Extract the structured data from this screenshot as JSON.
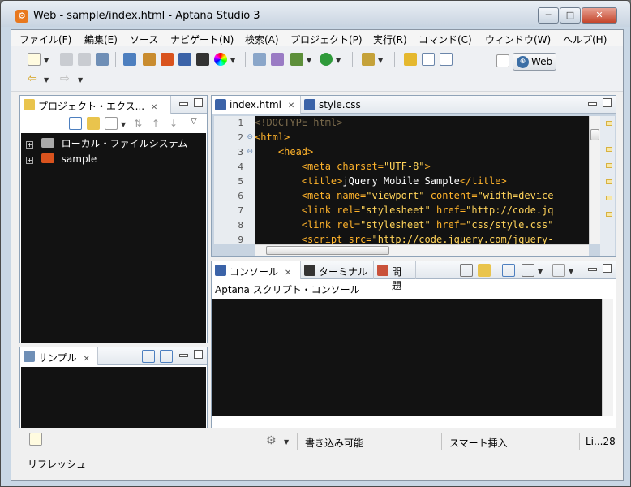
{
  "window": {
    "title": "Web - sample/index.html - Aptana Studio 3",
    "app_icon": "gear-icon",
    "controls": {
      "minimize": "─",
      "maximize": "□",
      "close": "✕"
    }
  },
  "menu": [
    "ファイル(F)",
    "編集(E)",
    "ソース",
    "ナビゲート(N)",
    "検索(A)",
    "プロジェクト(P)",
    "実行(R)",
    "コマンド(C)",
    "ウィンドウ(W)",
    "ヘルプ(H)"
  ],
  "perspective": {
    "label": "Web"
  },
  "project_explorer": {
    "tab_label": "プロジェクト・エクス...",
    "items": [
      {
        "label": "ローカル・ファイルシステム",
        "icon": "drive-icon"
      },
      {
        "label": "sample",
        "icon": "web-project-icon"
      }
    ]
  },
  "samples": {
    "tab_label": "サンプル"
  },
  "editor": {
    "tabs": [
      {
        "label": "index.html",
        "active": true
      },
      {
        "label": "style.css",
        "active": false
      }
    ],
    "lines": [
      {
        "n": "1",
        "fold": "",
        "indent": "",
        "parts": [
          [
            "doc",
            "<!DOCTYPE html>"
          ]
        ]
      },
      {
        "n": "2",
        "fold": "⊖",
        "indent": "",
        "parts": [
          [
            "tag",
            "<html>"
          ]
        ]
      },
      {
        "n": "3",
        "fold": "⊖",
        "indent": "    ",
        "parts": [
          [
            "tag",
            "<head>"
          ]
        ]
      },
      {
        "n": "4",
        "fold": "",
        "indent": "        ",
        "parts": [
          [
            "tag",
            "<meta "
          ],
          [
            "attr",
            "charset="
          ],
          [
            "val",
            "\"UTF-8\""
          ],
          [
            "tag",
            ">"
          ]
        ]
      },
      {
        "n": "5",
        "fold": "",
        "indent": "        ",
        "parts": [
          [
            "tag",
            "<title>"
          ],
          [
            "text",
            "jQuery Mobile Sample"
          ],
          [
            "tag",
            "</title>"
          ]
        ]
      },
      {
        "n": "6",
        "fold": "",
        "indent": "        ",
        "parts": [
          [
            "tag",
            "<meta "
          ],
          [
            "attr",
            "name="
          ],
          [
            "val",
            "\"viewport\""
          ],
          [
            "attr",
            " content="
          ],
          [
            "val",
            "\"width=device"
          ]
        ]
      },
      {
        "n": "7",
        "fold": "",
        "indent": "        ",
        "parts": [
          [
            "tag",
            "<link "
          ],
          [
            "attr",
            "rel="
          ],
          [
            "val",
            "\"stylesheet\""
          ],
          [
            "attr",
            " href="
          ],
          [
            "val",
            "\"http://code.jq"
          ]
        ]
      },
      {
        "n": "8",
        "fold": "",
        "indent": "        ",
        "parts": [
          [
            "tag",
            "<link "
          ],
          [
            "attr",
            "rel="
          ],
          [
            "val",
            "\"stylesheet\""
          ],
          [
            "attr",
            " href="
          ],
          [
            "val",
            "\"css/style.css\""
          ]
        ]
      },
      {
        "n": "9",
        "fold": "",
        "indent": "        ",
        "parts": [
          [
            "tag",
            "<script "
          ],
          [
            "attr",
            "src="
          ],
          [
            "val",
            "\"http://code.jquery.com/jquery-"
          ]
        ]
      }
    ]
  },
  "console_panel": {
    "tabs": [
      {
        "label": "コンソール",
        "closable": true
      },
      {
        "label": "ターミナル",
        "closable": false
      },
      {
        "label": "問題",
        "closable": false
      }
    ],
    "header": "Aptana スクリプト・コンソール"
  },
  "statusbar": {
    "writable": "書き込み可能",
    "insert_mode": "スマート挿入",
    "position": "Li...28",
    "message": "リフレッシュ"
  },
  "colors": {
    "editor_bg": "#121212",
    "tag": "#ffb32b",
    "value": "#ffd35a",
    "accent": "#e8781e"
  }
}
